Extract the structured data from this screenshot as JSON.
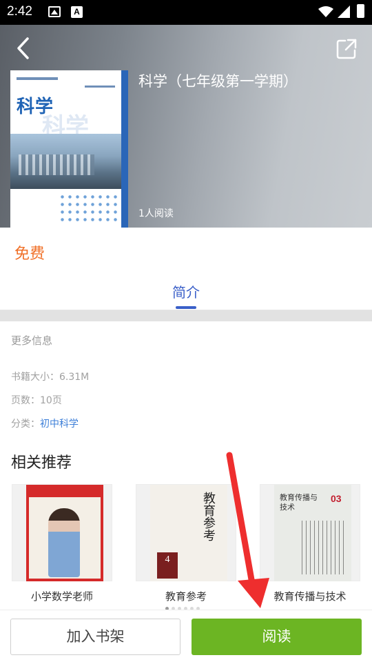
{
  "status_bar": {
    "time": "2:42",
    "icons": [
      "image-icon",
      "a-icon",
      "wifi-icon",
      "signal-icon",
      "battery-icon"
    ]
  },
  "header": {
    "back_icon": "chevron-left-icon",
    "share_icon": "share-icon",
    "book_title": "科学（七年级第一学期）",
    "read_count": "1人阅读",
    "cover": {
      "title": "科学",
      "accent_color": "#2a66b8"
    }
  },
  "price": "免费",
  "tabs": [
    {
      "label": "简介",
      "active": true
    }
  ],
  "info": {
    "heading": "更多信息",
    "size_label": "书籍大小：",
    "size_value": "6.31M",
    "pages_label": "页数：",
    "pages_value": "10页",
    "category_label": "分类：",
    "category_value": "初中科学"
  },
  "recommendations": {
    "title": "相关推荐",
    "items": [
      {
        "label": "小学数学老师"
      },
      {
        "label": "教育参考",
        "cover_text": "教育参考",
        "cover_number": "4"
      },
      {
        "label": "教育传播与技术",
        "cover_text": "教育传播与技术",
        "cover_number": "03"
      }
    ],
    "page_count": 6,
    "active_page": 0
  },
  "bottom_bar": {
    "add_shelf_label": "加入书架",
    "read_label": "阅读"
  },
  "colors": {
    "accent_blue": "#3a5fc8",
    "price_orange": "#f07028",
    "read_green": "#6cb523",
    "annotation_red": "#ee2e2e"
  }
}
